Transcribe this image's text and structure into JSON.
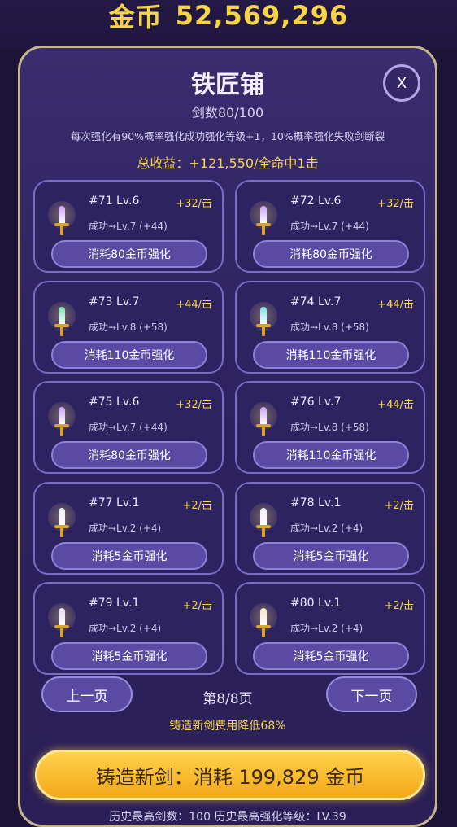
{
  "coins": {
    "label": "金币",
    "value": "52,569,296"
  },
  "panel": {
    "title": "铁匠铺",
    "close_label": "X",
    "subtitle": "剑数80/100",
    "description": "每次强化有90%概率强化成功强化等级+1，10%概率强化失败剑断裂",
    "income": "总收益：+121,550/全命中1击"
  },
  "cards": [
    {
      "name": "#71 Lv.6",
      "bonus": "+32/击",
      "success": "成功→Lv.7 (+44)",
      "button": "消耗80金币强化",
      "blade_color": "#c9a4f2"
    },
    {
      "name": "#72 Lv.6",
      "bonus": "+32/击",
      "success": "成功→Lv.7 (+44)",
      "button": "消耗80金币强化",
      "blade_color": "#c9a4f2"
    },
    {
      "name": "#73 Lv.7",
      "bonus": "+44/击",
      "success": "成功→Lv.8 (+58)",
      "button": "消耗110金币强化",
      "blade_color": "#7ee0b0"
    },
    {
      "name": "#74 Lv.7",
      "bonus": "+44/击",
      "success": "成功→Lv.8 (+58)",
      "button": "消耗110金币强化",
      "blade_color": "#7ee0e0"
    },
    {
      "name": "#75 Lv.6",
      "bonus": "+32/击",
      "success": "成功→Lv.7 (+44)",
      "button": "消耗80金币强化",
      "blade_color": "#c9a4f2"
    },
    {
      "name": "#76 Lv.7",
      "bonus": "+44/击",
      "success": "成功→Lv.8 (+58)",
      "button": "消耗110金币强化",
      "blade_color": "#c9a4f2"
    },
    {
      "name": "#77 Lv.1",
      "bonus": "+2/击",
      "success": "成功→Lv.2 (+4)",
      "button": "消耗5金币强化",
      "blade_color": "#eeeef4"
    },
    {
      "name": "#78 Lv.1",
      "bonus": "+2/击",
      "success": "成功→Lv.2 (+4)",
      "button": "消耗5金币强化",
      "blade_color": "#eeeef4"
    },
    {
      "name": "#79 Lv.1",
      "bonus": "+2/击",
      "success": "成功→Lv.2 (+4)",
      "button": "消耗5金币强化",
      "blade_color": "#e8d8f0"
    },
    {
      "name": "#80 Lv.1",
      "bonus": "+2/击",
      "success": "成功→Lv.2 (+4)",
      "button": "消耗5金币强化",
      "blade_color": "#f0e4c0"
    }
  ],
  "pagination": {
    "prev": "上一页",
    "next": "下一页",
    "info": "第8/8页"
  },
  "discount": "铸造新剑费用降低68%",
  "forge_button": "铸造新剑：消耗 199,829 金币",
  "history": "历史最高剑数：100    历史最高强化等级：LV.39"
}
